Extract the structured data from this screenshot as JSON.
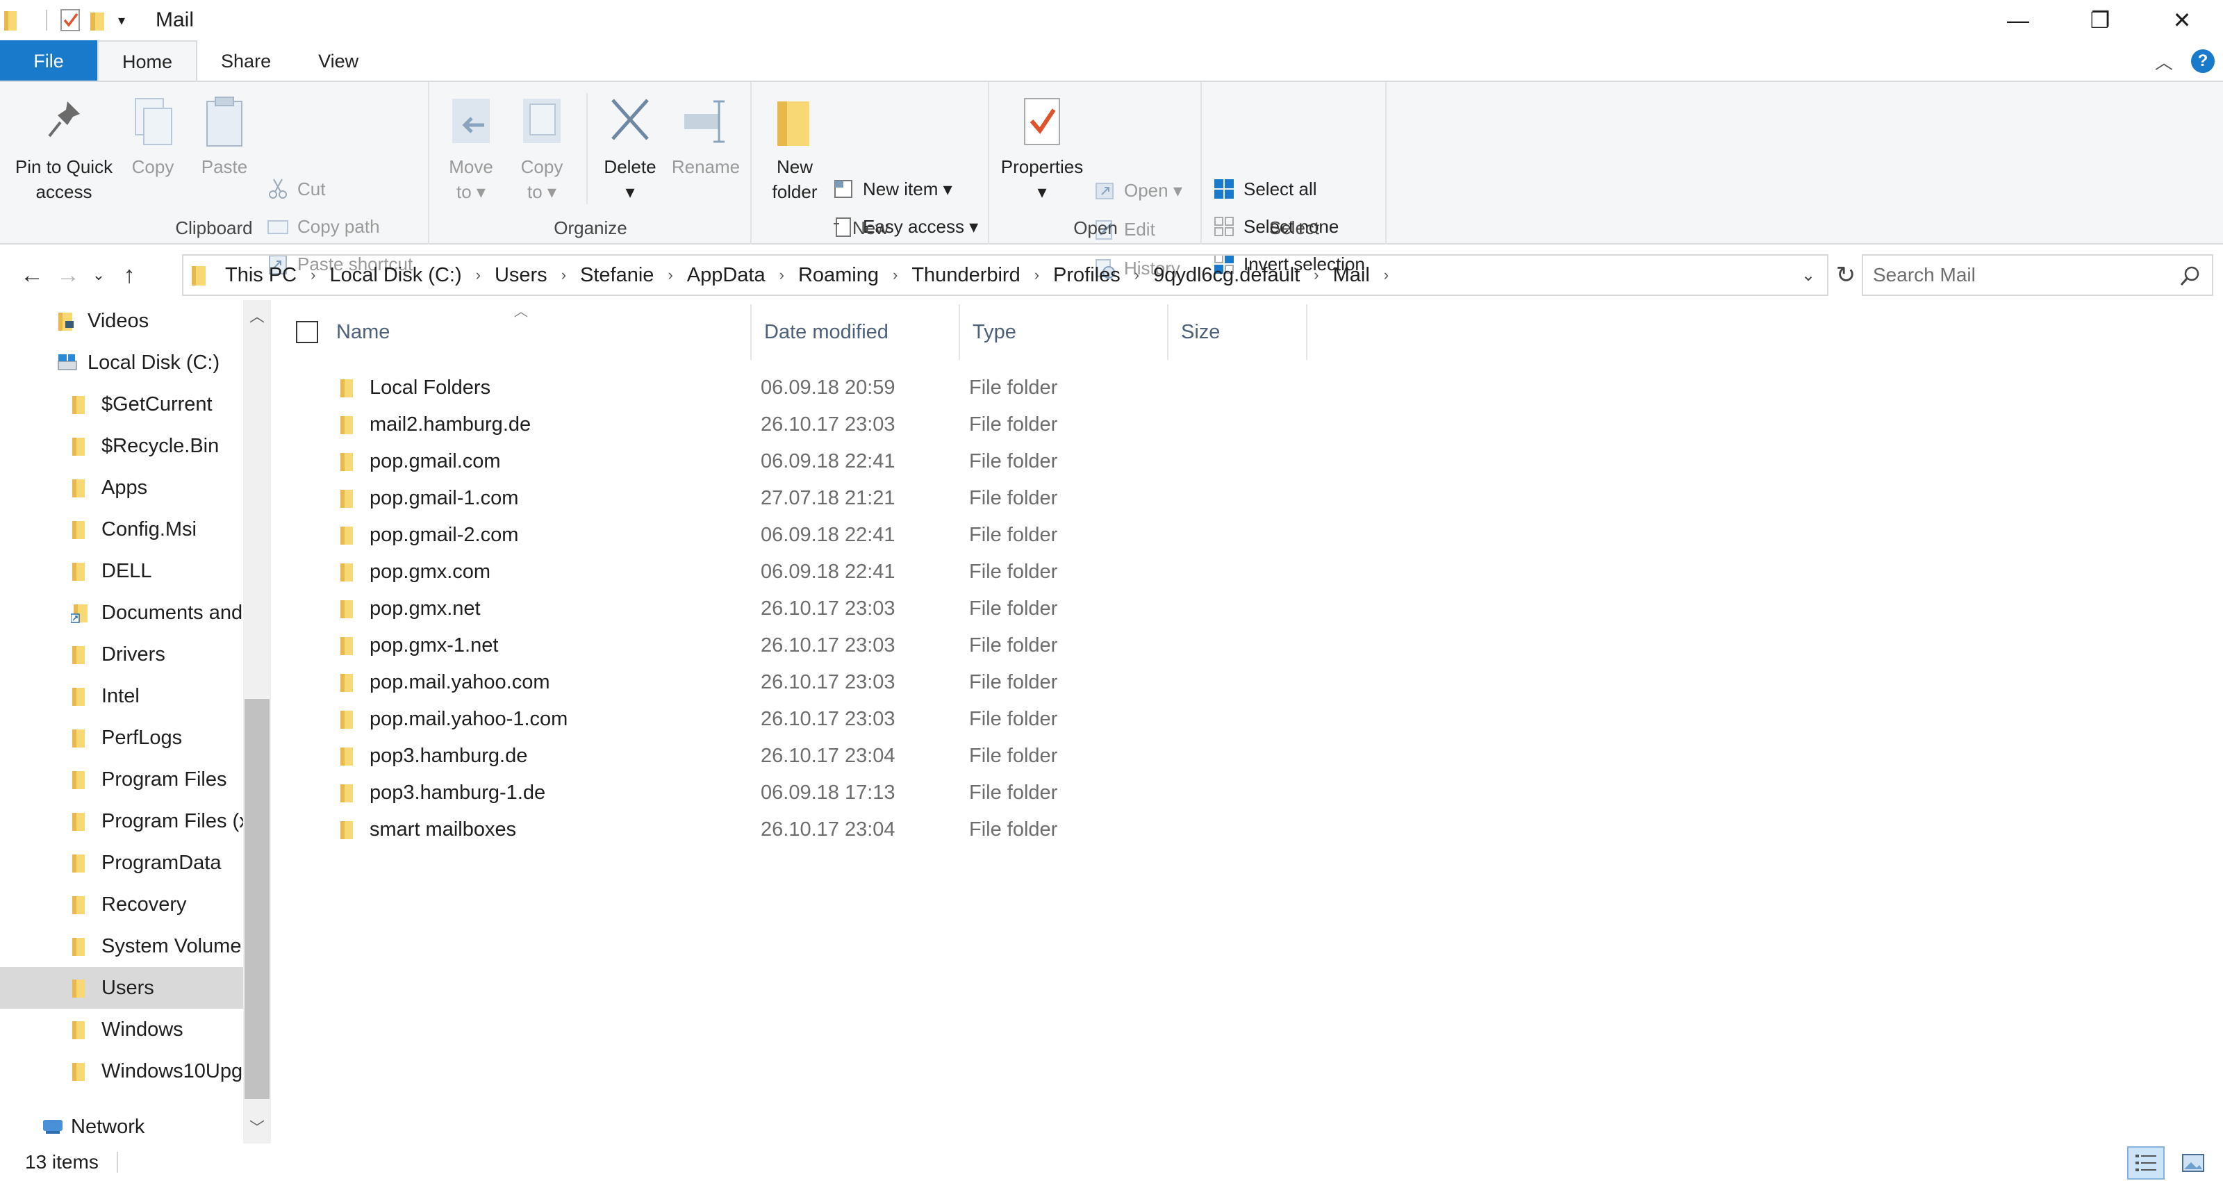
{
  "window": {
    "title": "Mail",
    "controls": {
      "minimize": "—",
      "maximize": "❐",
      "close": "✕"
    }
  },
  "ribbon_tabs": [
    {
      "label": "File"
    },
    {
      "label": "Home"
    },
    {
      "label": "Share"
    },
    {
      "label": "View"
    }
  ],
  "ribbon": {
    "clipboard": {
      "label": "Clipboard",
      "pin_line1": "Pin to Quick",
      "pin_line2": "access",
      "copy": "Copy",
      "paste": "Paste",
      "cut": "Cut",
      "copy_path": "Copy path",
      "paste_shortcut": "Paste shortcut"
    },
    "organize": {
      "label": "Organize",
      "move_line1": "Move",
      "move_line2": "to",
      "copy_line1": "Copy",
      "copy_line2": "to",
      "delete": "Delete",
      "rename": "Rename"
    },
    "new": {
      "label": "New",
      "folder_line1": "New",
      "folder_line2": "folder",
      "new_item": "New item",
      "easy_access": "Easy access"
    },
    "open": {
      "label": "Open",
      "properties": "Properties",
      "open": "Open",
      "edit": "Edit",
      "history": "History"
    },
    "select": {
      "label": "Select",
      "select_all": "Select all",
      "select_none": "Select none",
      "invert": "Invert selection"
    }
  },
  "address": {
    "crumbs": [
      "This PC",
      "Local Disk (C:)",
      "Users",
      "Stefanie",
      "AppData",
      "Roaming",
      "Thunderbird",
      "Profiles",
      "9qydl6cg.default",
      "Mail"
    ],
    "search_placeholder": "Search Mail"
  },
  "nav": {
    "items": [
      {
        "label": "Videos",
        "indent": 0,
        "icon": "videos-folder-icon"
      },
      {
        "label": "Local Disk (C:)",
        "indent": 0,
        "icon": "drive-icon"
      },
      {
        "label": "$GetCurrent",
        "indent": 1,
        "icon": "folder-icon"
      },
      {
        "label": "$Recycle.Bin",
        "indent": 1,
        "icon": "folder-icon"
      },
      {
        "label": "Apps",
        "indent": 1,
        "icon": "folder-icon"
      },
      {
        "label": "Config.Msi",
        "indent": 1,
        "icon": "folder-icon"
      },
      {
        "label": "DELL",
        "indent": 1,
        "icon": "folder-icon"
      },
      {
        "label": "Documents and",
        "indent": 1,
        "icon": "shortcut-folder-icon"
      },
      {
        "label": "Drivers",
        "indent": 1,
        "icon": "folder-icon"
      },
      {
        "label": "Intel",
        "indent": 1,
        "icon": "folder-icon"
      },
      {
        "label": "PerfLogs",
        "indent": 1,
        "icon": "folder-icon"
      },
      {
        "label": "Program Files",
        "indent": 1,
        "icon": "folder-icon"
      },
      {
        "label": "Program Files (x",
        "indent": 1,
        "icon": "folder-icon"
      },
      {
        "label": "ProgramData",
        "indent": 1,
        "icon": "folder-icon"
      },
      {
        "label": "Recovery",
        "indent": 1,
        "icon": "folder-icon"
      },
      {
        "label": "System Volume",
        "indent": 1,
        "icon": "folder-icon"
      },
      {
        "label": "Users",
        "indent": 1,
        "icon": "folder-icon",
        "selected": true
      },
      {
        "label": "Windows",
        "indent": 1,
        "icon": "folder-icon"
      },
      {
        "label": "Windows10Upg",
        "indent": 1,
        "icon": "folder-icon"
      },
      {
        "label": "Network",
        "indent": 0,
        "icon": "network-icon"
      }
    ]
  },
  "columns": {
    "name": "Name",
    "date": "Date modified",
    "type": "Type",
    "size": "Size"
  },
  "files": [
    {
      "name": "Local Folders",
      "date": "06.09.18 20:59",
      "type": "File folder"
    },
    {
      "name": "mail2.hamburg.de",
      "date": "26.10.17 23:03",
      "type": "File folder"
    },
    {
      "name": "pop.gmail.com",
      "date": "06.09.18 22:41",
      "type": "File folder"
    },
    {
      "name": "pop.gmail-1.com",
      "date": "27.07.18 21:21",
      "type": "File folder"
    },
    {
      "name": "pop.gmail-2.com",
      "date": "06.09.18 22:41",
      "type": "File folder"
    },
    {
      "name": "pop.gmx.com",
      "date": "06.09.18 22:41",
      "type": "File folder"
    },
    {
      "name": "pop.gmx.net",
      "date": "26.10.17 23:03",
      "type": "File folder"
    },
    {
      "name": "pop.gmx-1.net",
      "date": "26.10.17 23:03",
      "type": "File folder"
    },
    {
      "name": "pop.mail.yahoo.com",
      "date": "26.10.17 23:03",
      "type": "File folder"
    },
    {
      "name": "pop.mail.yahoo-1.com",
      "date": "26.10.17 23:03",
      "type": "File folder"
    },
    {
      "name": "pop3.hamburg.de",
      "date": "26.10.17 23:04",
      "type": "File folder"
    },
    {
      "name": "pop3.hamburg-1.de",
      "date": "06.09.18 17:13",
      "type": "File folder"
    },
    {
      "name": "smart mailboxes",
      "date": "26.10.17 23:04",
      "type": "File folder"
    }
  ],
  "status": {
    "count": "13 items"
  },
  "colors": {
    "accent": "#1979ca",
    "folder": "#f8d775",
    "selection": "#d9d9d9"
  }
}
